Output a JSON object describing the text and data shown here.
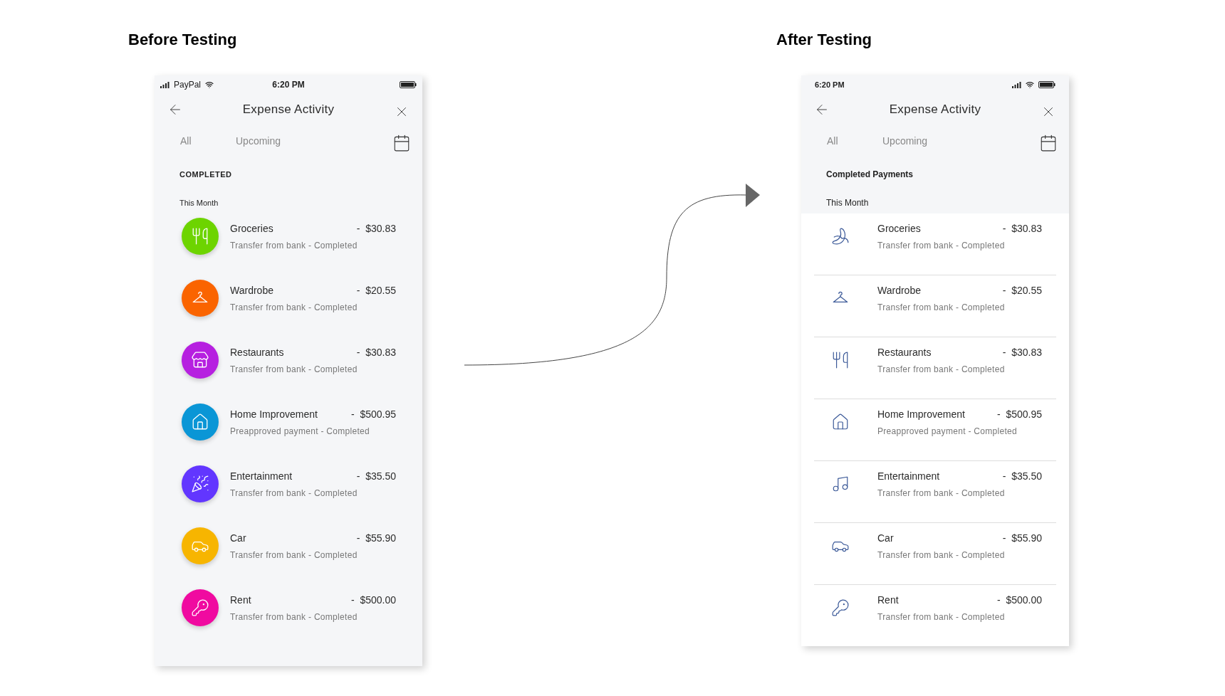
{
  "panels": [
    {
      "heading": "Before Testing",
      "kind": "colored",
      "status_bar": {
        "carrier": "PayPal",
        "time": "6:20 PM"
      },
      "title": "Expense Activity",
      "tabs": [
        "All",
        "Upcoming"
      ],
      "section": "COMPLETED",
      "group": "This Month",
      "items": [
        {
          "name": "Groceries",
          "amount": "-  $30.83",
          "detail": "Transfer from bank - Completed",
          "color": "#6dd400"
        },
        {
          "name": "Wardrobe",
          "amount": "-  $20.55",
          "detail": "Transfer from bank - Completed",
          "color": "#fa6400"
        },
        {
          "name": "Restaurants",
          "amount": "-  $30.83",
          "detail": "Transfer from bank - Completed",
          "color": "#b620e0"
        },
        {
          "name": "Home Improvement",
          "amount": "-  $500.95",
          "detail": "Preapproved payment - Completed",
          "color": "#0a96d6"
        },
        {
          "name": "Entertainment",
          "amount": "-  $35.50",
          "detail": "Transfer from bank - Completed",
          "color": "#6236ff"
        },
        {
          "name": "Car",
          "amount": "-  $55.90",
          "detail": "Transfer from bank - Completed",
          "color": "#f7b500"
        },
        {
          "name": "Rent",
          "amount": "-  $500.00",
          "detail": "Transfer from bank - Completed",
          "color": "#f00aa0"
        }
      ]
    },
    {
      "heading": "After Testing",
      "kind": "outline",
      "status_bar": {
        "time": "6:20 PM"
      },
      "title": "Expense Activity",
      "tabs": [
        "All",
        "Upcoming"
      ],
      "section": "Completed Payments",
      "group": "This Month",
      "items": [
        {
          "name": "Groceries",
          "amount": "-  $30.83",
          "detail": "Transfer from bank - Completed"
        },
        {
          "name": "Wardrobe",
          "amount": "-  $20.55",
          "detail": "Transfer from bank - Completed"
        },
        {
          "name": "Restaurants",
          "amount": "-  $30.83",
          "detail": "Transfer from bank - Completed"
        },
        {
          "name": "Home Improvement",
          "amount": "-  $500.95",
          "detail": "Preapproved payment - Completed"
        },
        {
          "name": "Entertainment",
          "amount": "-  $35.50",
          "detail": "Transfer from bank - Completed"
        },
        {
          "name": "Car",
          "amount": "-  $55.90",
          "detail": "Transfer from bank - Completed"
        },
        {
          "name": "Rent",
          "amount": "-  $500.00",
          "detail": "Transfer from bank - Completed"
        }
      ]
    }
  ]
}
